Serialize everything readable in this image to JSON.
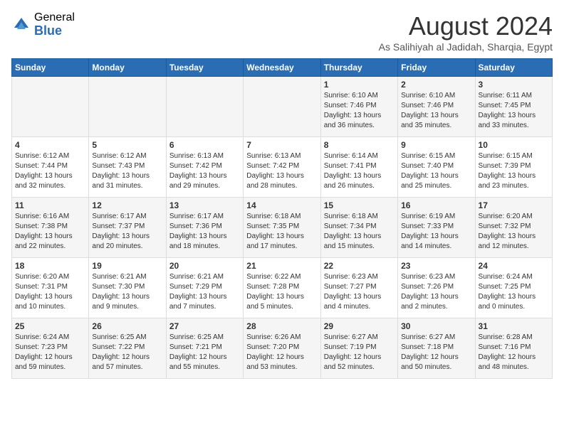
{
  "logo": {
    "general": "General",
    "blue": "Blue"
  },
  "title": {
    "month": "August 2024",
    "location": "As Salihiyah al Jadidah, Sharqia, Egypt"
  },
  "headers": [
    "Sunday",
    "Monday",
    "Tuesday",
    "Wednesday",
    "Thursday",
    "Friday",
    "Saturday"
  ],
  "weeks": [
    [
      {
        "day": "",
        "sunrise": "",
        "sunset": "",
        "daylight": ""
      },
      {
        "day": "",
        "sunrise": "",
        "sunset": "",
        "daylight": ""
      },
      {
        "day": "",
        "sunrise": "",
        "sunset": "",
        "daylight": ""
      },
      {
        "day": "",
        "sunrise": "",
        "sunset": "",
        "daylight": ""
      },
      {
        "day": "1",
        "sunrise": "Sunrise: 6:10 AM",
        "sunset": "Sunset: 7:46 PM",
        "daylight": "Daylight: 13 hours and 36 minutes."
      },
      {
        "day": "2",
        "sunrise": "Sunrise: 6:10 AM",
        "sunset": "Sunset: 7:46 PM",
        "daylight": "Daylight: 13 hours and 35 minutes."
      },
      {
        "day": "3",
        "sunrise": "Sunrise: 6:11 AM",
        "sunset": "Sunset: 7:45 PM",
        "daylight": "Daylight: 13 hours and 33 minutes."
      }
    ],
    [
      {
        "day": "4",
        "sunrise": "Sunrise: 6:12 AM",
        "sunset": "Sunset: 7:44 PM",
        "daylight": "Daylight: 13 hours and 32 minutes."
      },
      {
        "day": "5",
        "sunrise": "Sunrise: 6:12 AM",
        "sunset": "Sunset: 7:43 PM",
        "daylight": "Daylight: 13 hours and 31 minutes."
      },
      {
        "day": "6",
        "sunrise": "Sunrise: 6:13 AM",
        "sunset": "Sunset: 7:42 PM",
        "daylight": "Daylight: 13 hours and 29 minutes."
      },
      {
        "day": "7",
        "sunrise": "Sunrise: 6:13 AM",
        "sunset": "Sunset: 7:42 PM",
        "daylight": "Daylight: 13 hours and 28 minutes."
      },
      {
        "day": "8",
        "sunrise": "Sunrise: 6:14 AM",
        "sunset": "Sunset: 7:41 PM",
        "daylight": "Daylight: 13 hours and 26 minutes."
      },
      {
        "day": "9",
        "sunrise": "Sunrise: 6:15 AM",
        "sunset": "Sunset: 7:40 PM",
        "daylight": "Daylight: 13 hours and 25 minutes."
      },
      {
        "day": "10",
        "sunrise": "Sunrise: 6:15 AM",
        "sunset": "Sunset: 7:39 PM",
        "daylight": "Daylight: 13 hours and 23 minutes."
      }
    ],
    [
      {
        "day": "11",
        "sunrise": "Sunrise: 6:16 AM",
        "sunset": "Sunset: 7:38 PM",
        "daylight": "Daylight: 13 hours and 22 minutes."
      },
      {
        "day": "12",
        "sunrise": "Sunrise: 6:17 AM",
        "sunset": "Sunset: 7:37 PM",
        "daylight": "Daylight: 13 hours and 20 minutes."
      },
      {
        "day": "13",
        "sunrise": "Sunrise: 6:17 AM",
        "sunset": "Sunset: 7:36 PM",
        "daylight": "Daylight: 13 hours and 18 minutes."
      },
      {
        "day": "14",
        "sunrise": "Sunrise: 6:18 AM",
        "sunset": "Sunset: 7:35 PM",
        "daylight": "Daylight: 13 hours and 17 minutes."
      },
      {
        "day": "15",
        "sunrise": "Sunrise: 6:18 AM",
        "sunset": "Sunset: 7:34 PM",
        "daylight": "Daylight: 13 hours and 15 minutes."
      },
      {
        "day": "16",
        "sunrise": "Sunrise: 6:19 AM",
        "sunset": "Sunset: 7:33 PM",
        "daylight": "Daylight: 13 hours and 14 minutes."
      },
      {
        "day": "17",
        "sunrise": "Sunrise: 6:20 AM",
        "sunset": "Sunset: 7:32 PM",
        "daylight": "Daylight: 13 hours and 12 minutes."
      }
    ],
    [
      {
        "day": "18",
        "sunrise": "Sunrise: 6:20 AM",
        "sunset": "Sunset: 7:31 PM",
        "daylight": "Daylight: 13 hours and 10 minutes."
      },
      {
        "day": "19",
        "sunrise": "Sunrise: 6:21 AM",
        "sunset": "Sunset: 7:30 PM",
        "daylight": "Daylight: 13 hours and 9 minutes."
      },
      {
        "day": "20",
        "sunrise": "Sunrise: 6:21 AM",
        "sunset": "Sunset: 7:29 PM",
        "daylight": "Daylight: 13 hours and 7 minutes."
      },
      {
        "day": "21",
        "sunrise": "Sunrise: 6:22 AM",
        "sunset": "Sunset: 7:28 PM",
        "daylight": "Daylight: 13 hours and 5 minutes."
      },
      {
        "day": "22",
        "sunrise": "Sunrise: 6:23 AM",
        "sunset": "Sunset: 7:27 PM",
        "daylight": "Daylight: 13 hours and 4 minutes."
      },
      {
        "day": "23",
        "sunrise": "Sunrise: 6:23 AM",
        "sunset": "Sunset: 7:26 PM",
        "daylight": "Daylight: 13 hours and 2 minutes."
      },
      {
        "day": "24",
        "sunrise": "Sunrise: 6:24 AM",
        "sunset": "Sunset: 7:25 PM",
        "daylight": "Daylight: 13 hours and 0 minutes."
      }
    ],
    [
      {
        "day": "25",
        "sunrise": "Sunrise: 6:24 AM",
        "sunset": "Sunset: 7:23 PM",
        "daylight": "Daylight: 12 hours and 59 minutes."
      },
      {
        "day": "26",
        "sunrise": "Sunrise: 6:25 AM",
        "sunset": "Sunset: 7:22 PM",
        "daylight": "Daylight: 12 hours and 57 minutes."
      },
      {
        "day": "27",
        "sunrise": "Sunrise: 6:25 AM",
        "sunset": "Sunset: 7:21 PM",
        "daylight": "Daylight: 12 hours and 55 minutes."
      },
      {
        "day": "28",
        "sunrise": "Sunrise: 6:26 AM",
        "sunset": "Sunset: 7:20 PM",
        "daylight": "Daylight: 12 hours and 53 minutes."
      },
      {
        "day": "29",
        "sunrise": "Sunrise: 6:27 AM",
        "sunset": "Sunset: 7:19 PM",
        "daylight": "Daylight: 12 hours and 52 minutes."
      },
      {
        "day": "30",
        "sunrise": "Sunrise: 6:27 AM",
        "sunset": "Sunset: 7:18 PM",
        "daylight": "Daylight: 12 hours and 50 minutes."
      },
      {
        "day": "31",
        "sunrise": "Sunrise: 6:28 AM",
        "sunset": "Sunset: 7:16 PM",
        "daylight": "Daylight: 12 hours and 48 minutes."
      }
    ]
  ]
}
